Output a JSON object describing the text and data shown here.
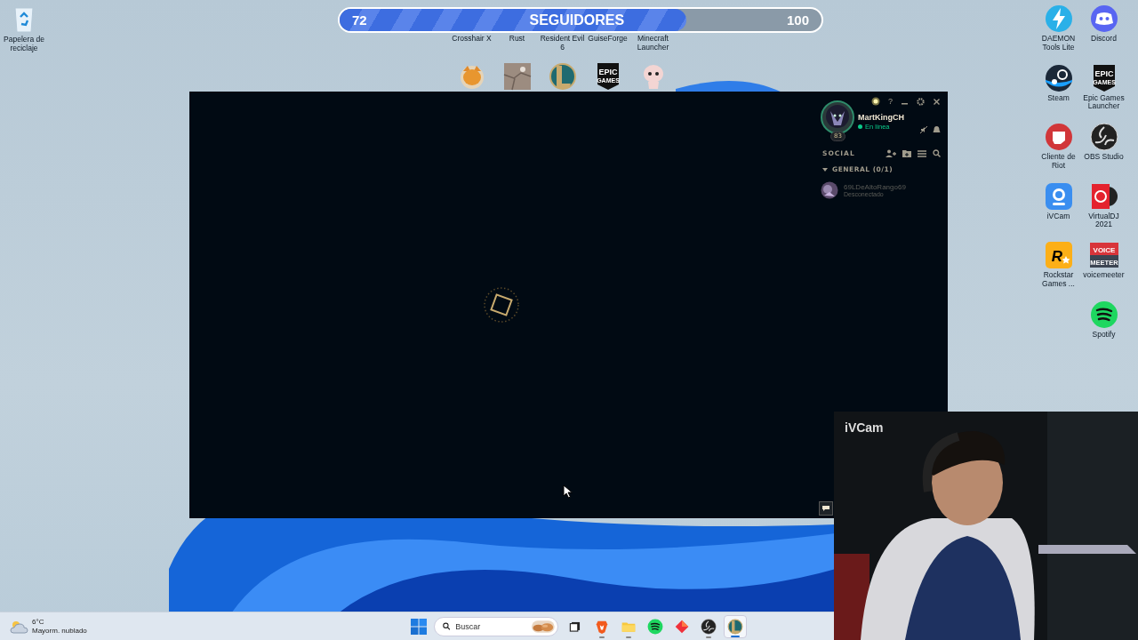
{
  "recycle_bin": {
    "label": "Papelera de reciclaje"
  },
  "follower_goal": {
    "current": "72",
    "label": "SEGUIDORES",
    "target": "100",
    "level": 0.72
  },
  "desktop_top_labels": [
    {
      "label": "Crosshair X"
    },
    {
      "label": "Rust"
    },
    {
      "label": "Resident Evil 6"
    },
    {
      "label": "GuiseForge"
    },
    {
      "label": "Minecraft Launcher"
    }
  ],
  "desktop_icons_row2": [
    {
      "kind": "fox"
    },
    {
      "kind": "stone"
    },
    {
      "kind": "league"
    },
    {
      "kind": "epic",
      "logo_text": [
        "EPIC",
        "GAMES"
      ]
    },
    {
      "kind": "baby"
    }
  ],
  "desktop_icon_columns": [
    {
      "icons": [
        {
          "kind": "daemon",
          "label": "DAEMON Tools Lite"
        },
        {
          "kind": "steam",
          "label": "Steam"
        },
        {
          "kind": "riot",
          "label": "Cliente de Riot"
        },
        {
          "kind": "ivcam",
          "label": "iVCam"
        },
        {
          "kind": "rockstar",
          "label": "Rockstar Games ...",
          "logo_text": [
            "R"
          ]
        }
      ]
    },
    {
      "icons": [
        {
          "kind": "discord",
          "label": "Discord"
        },
        {
          "kind": "epic",
          "label": "Epic Games Launcher",
          "logo_text": [
            "EPIC",
            "GAMES"
          ]
        },
        {
          "kind": "obs",
          "label": "OBS Studio"
        },
        {
          "kind": "virtualdj",
          "label": "VirtualDJ 2021"
        },
        {
          "kind": "voicemeeter",
          "label": "voicemeeter",
          "logo_text": [
            "VOICE",
            "MEETER"
          ]
        },
        {
          "kind": "spotify",
          "label": "Spotify"
        }
      ]
    }
  ],
  "client": {
    "help": "?",
    "profile": {
      "level": "83",
      "name": "MartKingCH",
      "status": "En línea",
      "online": true
    },
    "social": {
      "title": "SOCIAL",
      "groups": [
        {
          "name": "GENERAL (0/1)",
          "expanded": true,
          "friends": [
            {
              "name": "69LDeAltoRango69",
              "status": "Desconectado",
              "online": false
            }
          ]
        }
      ]
    }
  },
  "webcam": {
    "label": "iVCam"
  },
  "taskbar": {
    "weather": {
      "temperature": "6°C",
      "condition": "Mayorm. nublado"
    },
    "search": {
      "placeholder": "Buscar"
    },
    "apps": [
      {
        "kind": "taskview",
        "running": false,
        "selected": false
      },
      {
        "kind": "brave",
        "running": true,
        "selected": false
      },
      {
        "kind": "folder",
        "running": true,
        "selected": false
      },
      {
        "kind": "spotify",
        "running": false,
        "selected": false
      },
      {
        "kind": "diamond",
        "running": false,
        "selected": false
      },
      {
        "kind": "obs",
        "running": true,
        "selected": false
      },
      {
        "kind": "league",
        "running": true,
        "selected": true
      }
    ]
  }
}
